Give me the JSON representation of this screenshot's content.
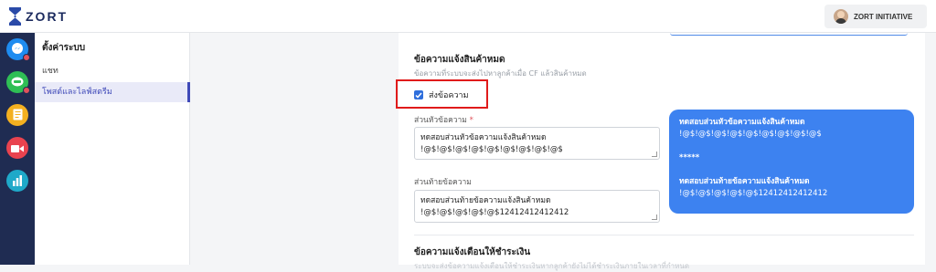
{
  "app": {
    "brand": "ZORT"
  },
  "user": {
    "name": "ZORT INITIATIVE"
  },
  "rail": {
    "icons": [
      {
        "name": "messenger",
        "color": "#1e8cf0",
        "badge": true
      },
      {
        "name": "line",
        "color": "#2fbf55",
        "badge": true
      },
      {
        "name": "notes",
        "color": "#f3b020",
        "badge": false
      },
      {
        "name": "video",
        "color": "#e9434f",
        "badge": false
      },
      {
        "name": "chart",
        "color": "#1fa9c9",
        "badge": false
      }
    ]
  },
  "settings_nav": {
    "title": "ตั้งค่าระบบ",
    "items": [
      {
        "label": "แชท",
        "active": false
      },
      {
        "label": "โพสต์และไลฟ์สตรีม",
        "active": true
      }
    ]
  },
  "out_of_stock": {
    "title": "ข้อความแจ้งสินค้าหมด",
    "subtitle": "ข้อความที่ระบบจะส่งไปหาลูกค้าเมื่อ CF แล้วสินค้าหมด",
    "send_label": "ส่งข้อความ",
    "header_label": "ส่วนหัวข้อความ",
    "header_required": "*",
    "header_value_line1": "ทดสอบส่วนหัวข้อความแจ้งสินค้าหมด",
    "header_value_line2": "!@$!@$!@$!@$!@$!@$!@$!@$!@$",
    "footer_label": "ส่วนท้ายข้อความ",
    "footer_value_line1": "ทดสอบส่วนท้ายข้อความแจ้งสินค้าหมด",
    "footer_value_line2": "!@$!@$!@$!@$!@$12412412412412"
  },
  "preview": {
    "line1": "ทดสอบส่วนหัวข้อความแจ้งสินค้าหมด",
    "line2": "!@$!@$!@$!@$!@$!@$!@$!@$!@$",
    "line3": "*****",
    "line4": "ทดสอบส่วนท้ายข้อความแจ้งสินค้าหมด",
    "line5": "!@$!@$!@$!@$!@$12412412412412"
  },
  "payment_reminder": {
    "title": "ข้อความแจ้งเตือนให้ชำระเงิน",
    "subtitle": "ระบบจะส่งข้อความแจ้งเตือนให้ชำระเงินหากลูกค้ายังไม่ได้ชำระเงินภายในเวลาที่กำหนด"
  }
}
